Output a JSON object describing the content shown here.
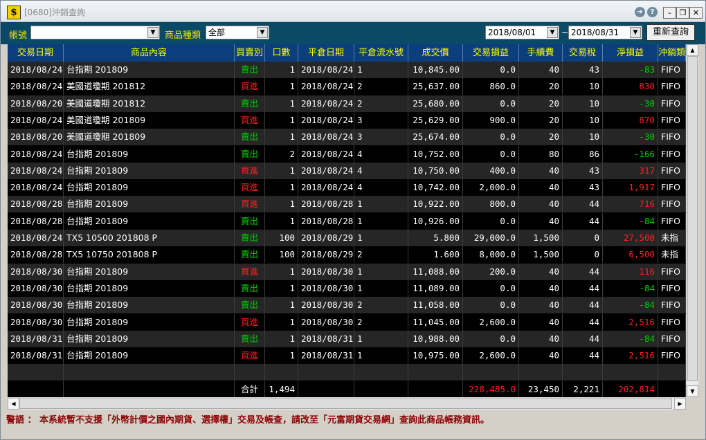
{
  "window": {
    "title": "[0680]沖銷查詢",
    "app_icon": "$"
  },
  "toolbar": {
    "account_label": "帳號",
    "account_value": "",
    "product_type_label": "商品種類",
    "product_type_value": "全部",
    "date_from": "2018/08/01",
    "date_to": "2018/08/31",
    "range_sep": "~",
    "requery_label": "重新查詢"
  },
  "table": {
    "columns": [
      "交易日期",
      "商品內容",
      "買賣別",
      "口數",
      "平倉日期",
      "平倉流水號",
      "成交價",
      "交易損益",
      "手續費",
      "交易稅",
      "淨損益",
      "沖銷類"
    ],
    "rows": [
      [
        "2018/08/24",
        "台指期 201809",
        "賣出",
        "1",
        "2018/08/24",
        "1",
        "10,845.00",
        "0.0",
        "40",
        "43",
        "-83",
        "FIFO"
      ],
      [
        "2018/08/24",
        "美國道瓊期 201812",
        "買進",
        "1",
        "2018/08/24",
        "2",
        "25,637.00",
        "860.0",
        "20",
        "10",
        "830",
        "FIFO"
      ],
      [
        "2018/08/20",
        "美國道瓊期 201812",
        "賣出",
        "1",
        "2018/08/24",
        "2",
        "25,680.00",
        "0.0",
        "20",
        "10",
        "-30",
        "FIFO"
      ],
      [
        "2018/08/24",
        "美國道瓊期 201809",
        "買進",
        "1",
        "2018/08/24",
        "3",
        "25,629.00",
        "900.0",
        "20",
        "10",
        "870",
        "FIFO"
      ],
      [
        "2018/08/20",
        "美國道瓊期 201809",
        "賣出",
        "1",
        "2018/08/24",
        "3",
        "25,674.00",
        "0.0",
        "20",
        "10",
        "-30",
        "FIFO"
      ],
      [
        "2018/08/24",
        "台指期 201809",
        "賣出",
        "2",
        "2018/08/24",
        "4",
        "10,752.00",
        "0.0",
        "80",
        "86",
        "-166",
        "FIFO"
      ],
      [
        "2018/08/24",
        "台指期 201809",
        "買進",
        "1",
        "2018/08/24",
        "4",
        "10,750.00",
        "400.0",
        "40",
        "43",
        "317",
        "FIFO"
      ],
      [
        "2018/08/24",
        "台指期 201809",
        "買進",
        "1",
        "2018/08/24",
        "4",
        "10,742.00",
        "2,000.0",
        "40",
        "43",
        "1,917",
        "FIFO"
      ],
      [
        "2018/08/28",
        "台指期 201809",
        "買進",
        "1",
        "2018/08/28",
        "1",
        "10,922.00",
        "800.0",
        "40",
        "44",
        "716",
        "FIFO"
      ],
      [
        "2018/08/28",
        "台指期 201809",
        "賣出",
        "1",
        "2018/08/28",
        "1",
        "10,926.00",
        "0.0",
        "40",
        "44",
        "-84",
        "FIFO"
      ],
      [
        "2018/08/24",
        "TX5 10500 201808 P",
        "賣出",
        "100",
        "2018/08/29",
        "1",
        "5.800",
        "29,000.0",
        "1,500",
        "0",
        "27,500",
        "未指"
      ],
      [
        "2018/08/28",
        "TX5 10750 201808 P",
        "賣出",
        "100",
        "2018/08/29",
        "2",
        "1.600",
        "8,000.0",
        "1,500",
        "0",
        "6,500",
        "未指"
      ],
      [
        "2018/08/30",
        "台指期 201809",
        "買進",
        "1",
        "2018/08/30",
        "1",
        "11,088.00",
        "200.0",
        "40",
        "44",
        "116",
        "FIFO"
      ],
      [
        "2018/08/30",
        "台指期 201809",
        "賣出",
        "1",
        "2018/08/30",
        "1",
        "11,089.00",
        "0.0",
        "40",
        "44",
        "-84",
        "FIFO"
      ],
      [
        "2018/08/30",
        "台指期 201809",
        "賣出",
        "1",
        "2018/08/30",
        "2",
        "11,058.00",
        "0.0",
        "40",
        "44",
        "-84",
        "FIFO"
      ],
      [
        "2018/08/30",
        "台指期 201809",
        "買進",
        "1",
        "2018/08/30",
        "2",
        "11,045.00",
        "2,600.0",
        "40",
        "44",
        "2,516",
        "FIFO"
      ],
      [
        "2018/08/31",
        "台指期 201809",
        "賣出",
        "1",
        "2018/08/31",
        "1",
        "10,988.00",
        "0.0",
        "40",
        "44",
        "-84",
        "FIFO"
      ],
      [
        "2018/08/31",
        "台指期 201809",
        "買進",
        "1",
        "2018/08/31",
        "1",
        "10,975.00",
        "2,600.0",
        "40",
        "44",
        "2,516",
        "FIFO"
      ]
    ],
    "total": {
      "label": "合計",
      "qty": "1,494",
      "trade_pl": "228,485.0",
      "fee": "23,450",
      "tax": "2,221",
      "net_pl": "202,814"
    }
  },
  "colors": {
    "sell": "#00d000",
    "buy": "#ff2020",
    "header_bg": "#0b3e7c",
    "header_text": "#ffff00",
    "toolbar_bg": "#0a4a66"
  },
  "warning": "警語 ： 本系統暫不支援「外幣計價之國內期貨、選擇權」交易及帳查，請改至「元富期貨交易網」查詢此商品帳務資訊。"
}
